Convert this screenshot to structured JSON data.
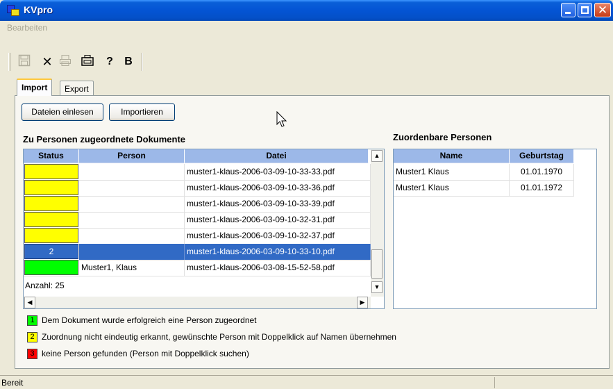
{
  "window": {
    "title": "KVpro"
  },
  "menu": {
    "items": [
      "Bearbeiten"
    ]
  },
  "toolbar": {
    "buttons": [
      {
        "icon": "save-icon",
        "glyph": "💾",
        "enabled": false
      },
      {
        "icon": "delete-icon",
        "glyph": "✕",
        "enabled": true
      },
      {
        "icon": "print-icon",
        "glyph": "⎙",
        "enabled": false
      },
      {
        "icon": "scanner-icon",
        "glyph": "⌂",
        "enabled": true
      },
      {
        "icon": "help-icon",
        "glyph": "?",
        "enabled": true
      },
      {
        "icon": "bold-b-icon",
        "glyph": "B",
        "enabled": true
      }
    ]
  },
  "tabs": [
    {
      "label": "Import"
    },
    {
      "label": "Export"
    }
  ],
  "import": {
    "read_files_label": "Dateien einlesen",
    "import_label": "Importieren",
    "documents_title": "Zu Personen zugeordnete Dokumente",
    "persons_title": "Zuordenbare Personen",
    "columns": {
      "status": "Status",
      "person": "Person",
      "file": "Datei"
    },
    "rows": [
      {
        "status": "",
        "status_color": "#ffff00",
        "person": "",
        "file": "muster1-klaus-2006-03-09-10-33-33.pdf",
        "selected": false
      },
      {
        "status": "",
        "status_color": "#ffff00",
        "person": "",
        "file": "muster1-klaus-2006-03-09-10-33-36.pdf",
        "selected": false
      },
      {
        "status": "",
        "status_color": "#ffff00",
        "person": "",
        "file": "muster1-klaus-2006-03-09-10-33-39.pdf",
        "selected": false
      },
      {
        "status": "",
        "status_color": "#ffff00",
        "person": "",
        "file": "muster1-klaus-2006-03-09-10-32-31.pdf",
        "selected": false
      },
      {
        "status": "",
        "status_color": "#ffff00",
        "person": "",
        "file": "muster1-klaus-2006-03-09-10-32-37.pdf",
        "selected": false
      },
      {
        "status": "2",
        "status_color": "#316ac5",
        "person": "",
        "file": "muster1-klaus-2006-03-09-10-33-10.pdf",
        "selected": true
      },
      {
        "status": "",
        "status_color": "#00ff00",
        "person": "Muster1, Klaus",
        "file": "muster1-klaus-2006-03-08-15-52-58.pdf",
        "selected": false
      }
    ],
    "count_label": "Anzahl: 25",
    "person_columns": {
      "name": "Name",
      "birthday": "Geburtstag"
    },
    "persons": [
      {
        "name": "Muster1 Klaus",
        "birthday": "01.01.1970"
      },
      {
        "name": "Muster1 Klaus",
        "birthday": "01.01.1972"
      }
    ],
    "legend": [
      {
        "code": "1",
        "color": "#00ff00",
        "text": "Dem Dokument wurde erfolgreich eine Person zugeordnet"
      },
      {
        "code": "2",
        "color": "#ffff00",
        "text": "Zuordnung nicht eindeutig erkannt, gewünschte Person mit Doppelklick auf Namen übernehmen"
      },
      {
        "code": "3",
        "color": "#ff0000",
        "text": "keine Person gefunden (Person mit Doppelklick suchen)"
      }
    ]
  },
  "statusbar": {
    "text": "Bereit"
  }
}
